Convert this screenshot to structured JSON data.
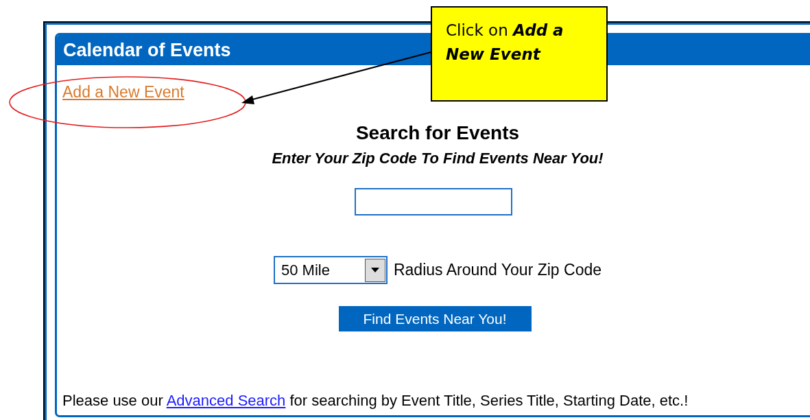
{
  "panel": {
    "title": "Calendar of Events"
  },
  "add_link": "Add a New Event",
  "search": {
    "title": "Search for Events",
    "subtitle": "Enter Your Zip Code To Find Events Near You!",
    "radius": {
      "value": "50 Mile",
      "label": "Radius Around Your Zip Code"
    },
    "button": "Find Events Near You!"
  },
  "footer": {
    "before": "Please use our",
    "link": "Advanced Search",
    "after": "for searching by Event Title, Series Title, Starting Date, etc.!"
  },
  "callout": {
    "text": "Click on **Add a New Event**"
  }
}
